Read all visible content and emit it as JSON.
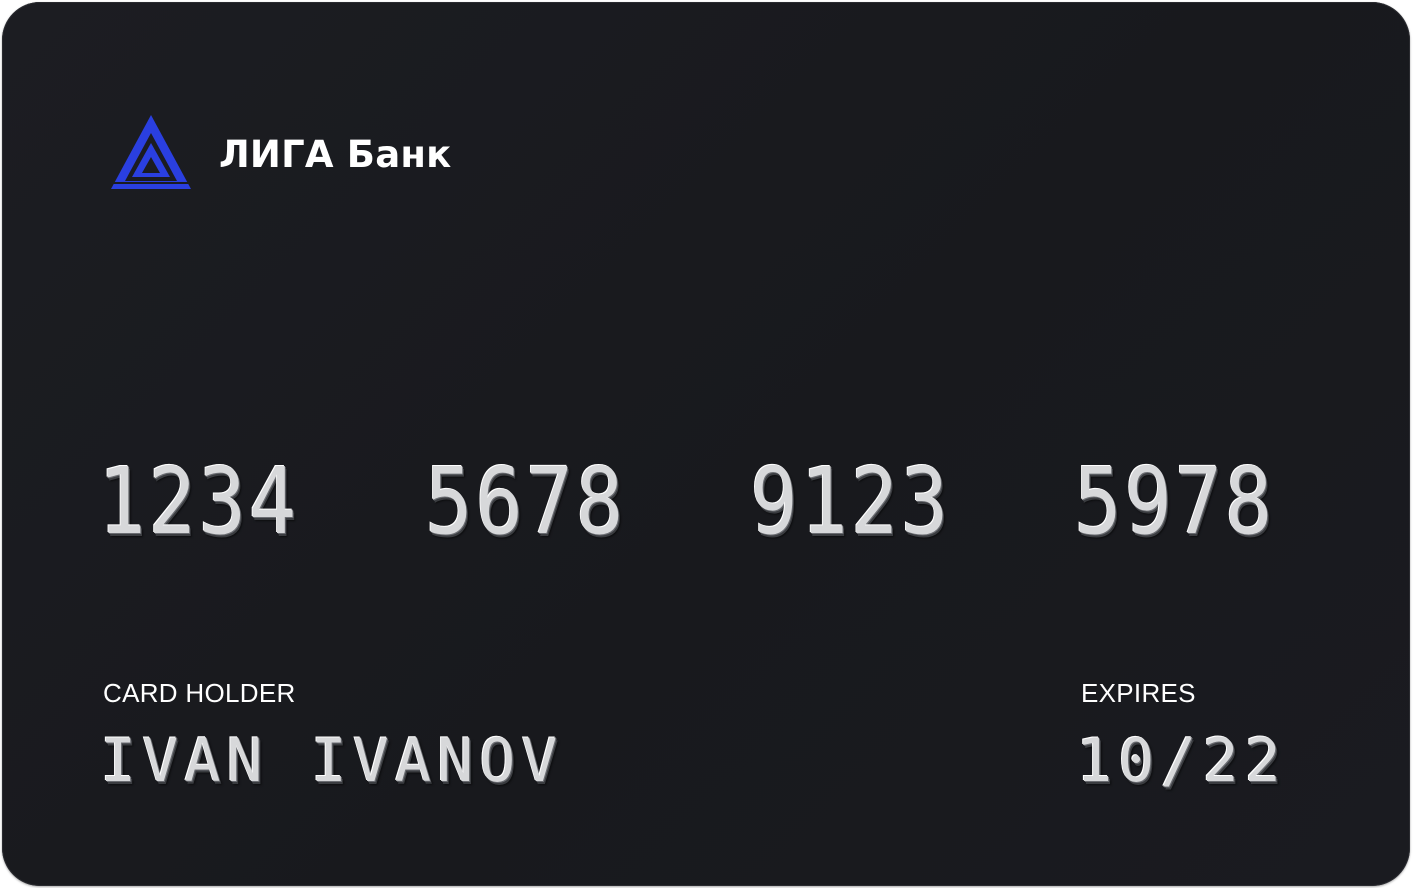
{
  "card": {
    "bank_name": "ЛИГА Банк",
    "logo_icon": "triangle-logo-icon",
    "brand_color": "#2a3fe0",
    "number_groups": [
      "1234",
      "5678",
      "9123",
      "5978"
    ],
    "holder_label": "CARD HOLDER",
    "holder_name": "IVAN IVANOV",
    "expires_label": "EXPIRES",
    "expires_value": "10/22"
  }
}
